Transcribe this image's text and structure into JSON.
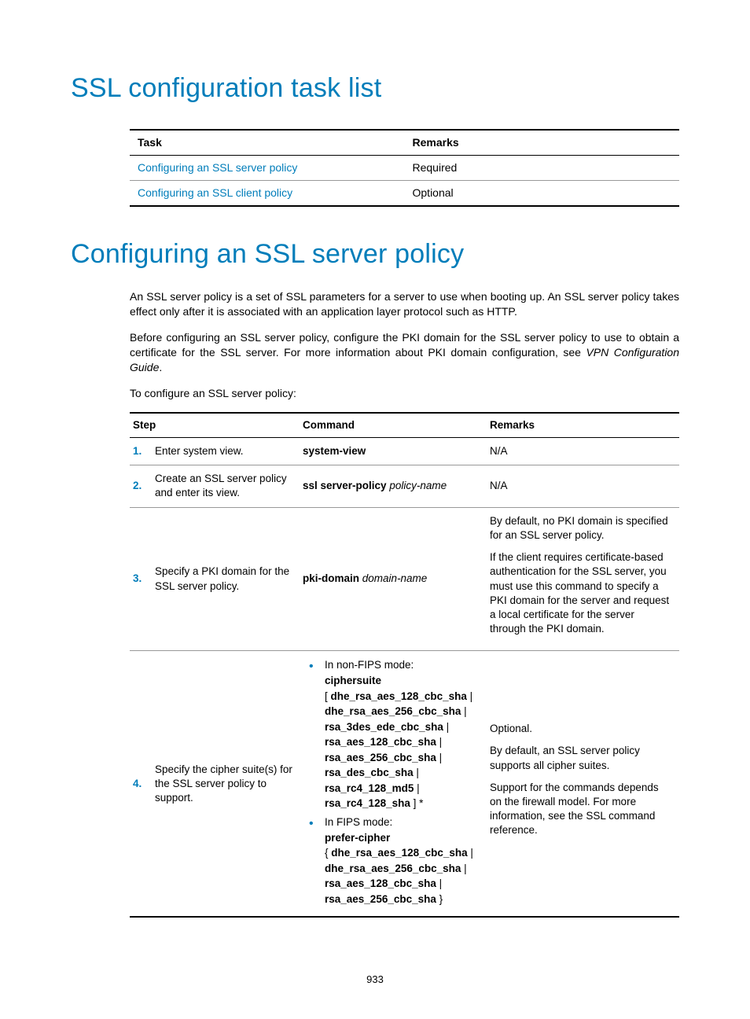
{
  "heading1": "SSL configuration task list",
  "taskTable": {
    "headers": {
      "task": "Task",
      "remarks": "Remarks"
    },
    "rows": [
      {
        "task": "Configuring an SSL server policy",
        "remarks": "Required"
      },
      {
        "task": "Configuring an SSL client policy",
        "remarks": "Optional"
      }
    ]
  },
  "heading2": "Configuring an SSL server policy",
  "para1": "An SSL server policy is a set of SSL parameters for a server to use when booting up. An SSL server policy takes effect only after it is associated with an application layer protocol such as HTTP.",
  "para2_a": "Before configuring an SSL server policy, configure the PKI domain for the SSL server policy to use to obtain a certificate for the SSL server. For more information about PKI domain configuration, see ",
  "para2_b": "VPN Configuration Guide",
  "para2_c": ".",
  "para3": "To configure an SSL server policy:",
  "stepsTable": {
    "headers": {
      "step": "Step",
      "command": "Command",
      "remarks": "Remarks"
    },
    "rows": [
      {
        "num": "1.",
        "desc": "Enter system view.",
        "cmd_bold": "system-view",
        "remarks_plain": "N/A"
      },
      {
        "num": "2.",
        "desc": "Create an SSL server policy and enter its view.",
        "cmd_bold": "ssl server-policy",
        "cmd_ital": " policy-name",
        "remarks_plain": "N/A"
      },
      {
        "num": "3.",
        "desc": "Specify a PKI domain for the SSL server policy.",
        "cmd_bold": "pki-domain",
        "cmd_ital": " domain-name",
        "remarks_p1": "By default, no PKI domain is specified for an SSL server policy.",
        "remarks_p2": "If the client requires certificate-based authentication for the SSL server, you must use this command to specify a PKI domain for the server and request a local certificate for the server through the PKI domain."
      },
      {
        "num": "4.",
        "desc": "Specify the cipher suite(s) for the SSL server policy to support.",
        "bullets": {
          "b1_lead": "In non-FIPS mode:",
          "b1_l1": "ciphersuite",
          "b1_l2a": "[ ",
          "b1_l2b": "dhe_rsa_aes_128_cbc_sha",
          "b1_l2c": " |",
          "b1_l3a": "dhe_rsa_aes_256_cbc_sha",
          "b1_l3b": " |",
          "b1_l4a": "rsa_3des_ede_cbc_sha",
          "b1_l4b": " |",
          "b1_l5a": "rsa_aes_128_cbc_sha",
          "b1_l5b": " |",
          "b1_l6a": "rsa_aes_256_cbc_sha",
          "b1_l6b": " |",
          "b1_l7a": "rsa_des_cbc_sha",
          "b1_l7b": " |",
          "b1_l8a": "rsa_rc4_128_md5",
          "b1_l8b": " |",
          "b1_l9a": "rsa_rc4_128_sha",
          "b1_l9b": " ] *",
          "b2_lead": "In FIPS mode:",
          "b2_l1": "prefer-cipher",
          "b2_l2a": "{ ",
          "b2_l2b": "dhe_rsa_aes_128_cbc_sha",
          "b2_l2c": " |",
          "b2_l3a": "dhe_rsa_aes_256_cbc_sha",
          "b2_l3b": " |",
          "b2_l4a": "rsa_aes_128_cbc_sha",
          "b2_l4b": " |",
          "b2_l5a": "rsa_aes_256_cbc_sha",
          "b2_l5b": " }"
        },
        "remarks_p1": "Optional.",
        "remarks_p2": "By default, an SSL server policy supports all cipher suites.",
        "remarks_p3": "Support for the commands depends on the firewall model. For more information, see the SSL command reference."
      }
    ]
  },
  "pageNumber": "933"
}
